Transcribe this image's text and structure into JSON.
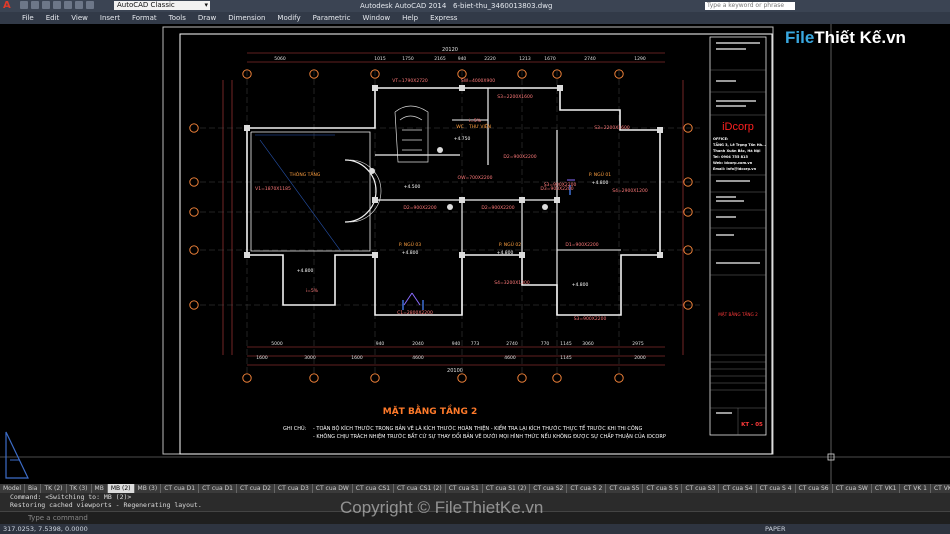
{
  "titlebar": {
    "app_title": "Autodesk AutoCAD 2014",
    "file_name": "6-biet-thu_3460013803.dwg",
    "workspace": "AutoCAD Classic",
    "search_placeholder": "Type a keyword or phrase"
  },
  "menu": [
    "File",
    "Edit",
    "View",
    "Insert",
    "Format",
    "Tools",
    "Draw",
    "Dimension",
    "Modify",
    "Parametric",
    "Window",
    "Help",
    "Express"
  ],
  "drawing": {
    "title": "MẶT BẰNG TẦNG 2",
    "note_label": "GHI CHÚ:",
    "note1": "- TOÀN BỘ KÍCH THƯỚC TRONG BẢN VẼ LÀ KÍCH THƯỚC HOÀN THIỆN - KIỂM TRA LẠI KÍCH THƯỚC THỰC TẾ TRƯỚC KHI THI CÔNG",
    "note2": "- KHÔNG CHỊU TRÁCH NHIỆM TRƯỚC BẤT CỨ SỰ THAY ĐỔI BẢN VẼ DƯỚI MỌI HÌNH THỨC NẾU KHÔNG ĐƯỢC SỰ CHẤP THUẬN CỦA IDCORP",
    "dim_top_total": "20120",
    "dim_top": [
      "5060",
      "1015",
      "1750",
      "2165",
      "940",
      "2220",
      "1213",
      "1670",
      "2740",
      "1290"
    ],
    "dim_bottom_total": "20100",
    "dim_bottom1": [
      "5000",
      "940",
      "2040",
      "940",
      "773",
      "2740",
      "770",
      "1145",
      "3060",
      "2975"
    ],
    "dim_bottom2": [
      "1600",
      "3000",
      "1600",
      "4600",
      "4600",
      "1145",
      "2000"
    ],
    "rooms": [
      "THÔNG TẦNG",
      "P. NGỦ 03",
      "P. NGỦ 02",
      "P. NGỦ 01",
      "THƯ VIỆN",
      "WC"
    ],
    "levels": [
      "+4.800",
      "+4.750",
      "+4.500",
      "+4.800",
      "+4.800",
      "+4.800",
      "+4.800"
    ],
    "labels": [
      "VT=1790X2720",
      "SW=4000X900",
      "S3=2200X1600",
      "S3=2200X1600",
      "D2=900X2200",
      "D2=900X2200",
      "D3=900X2200",
      "OW=700X2200",
      "C1=2800X2200",
      "S4=3200X1300",
      "S3=900X2200",
      "S4=2900X1200",
      "V1=1870X1185",
      "D2=900X2200",
      "D1=900X2200",
      "S3=900X2200",
      "i=5%",
      "i=5%"
    ],
    "grid": [
      "1",
      "2",
      "3",
      "4",
      "5",
      "6",
      "7",
      "A",
      "B",
      "C",
      "D",
      "E"
    ]
  },
  "title_block": {
    "company": "iDcorp",
    "office_label": "OFFICE:",
    "address1": "TẦNG 3, Lê Trọng Tấn Hà...",
    "address2": "Thanh Xuân Bắc, Hà Nội",
    "tel": "Tel: 0904 755 815",
    "web": "Web: idcorp.com.vn",
    "email": "Email: info@idcorp.vn",
    "sheet_title": "MẶT BẰNG TẦNG 2",
    "sheet_no": "KT - 05"
  },
  "layout_tabs": [
    "Model",
    "Bia",
    "TK (2)",
    "TK (3)",
    "MB",
    "MB (2)",
    "MB (3)",
    "CT cua D1",
    "CT cua D1",
    "CT cua D2",
    "CT cua D3",
    "CT cua DW",
    "CT cua CS1",
    "CT cua CS1 (2)",
    "CT cua S1",
    "CT cua S1 (2)",
    "CT cua S2",
    "CT cua S 2",
    "CT cua S5",
    "CT cua S 5",
    "CT cua S3",
    "CT cua S4",
    "CT cua S 4",
    "CT cua S6",
    "CT cua SW",
    "CT VK1",
    "CT VK 1",
    "CT VK"
  ],
  "active_tab": "MB (2)",
  "command_history": [
    "Command: <Switching to: MB (2)>",
    "Restoring cached viewports - Regenerating layout."
  ],
  "command_placeholder": "Type a command",
  "status": {
    "coords": "317.0253, 7.5398, 0.0000",
    "mode": "PAPER"
  },
  "watermark": {
    "brand_a": "File",
    "brand_b": "Thiết Kế",
    "brand_c": ".vn",
    "copyright": "Copyright © FileThietKe.vn"
  },
  "colors": {
    "wall": "#ffffff",
    "dim": "#ff4040",
    "grid": "#ff8a3d",
    "room_label": "#ffa040",
    "accent": "#39a8e0"
  }
}
